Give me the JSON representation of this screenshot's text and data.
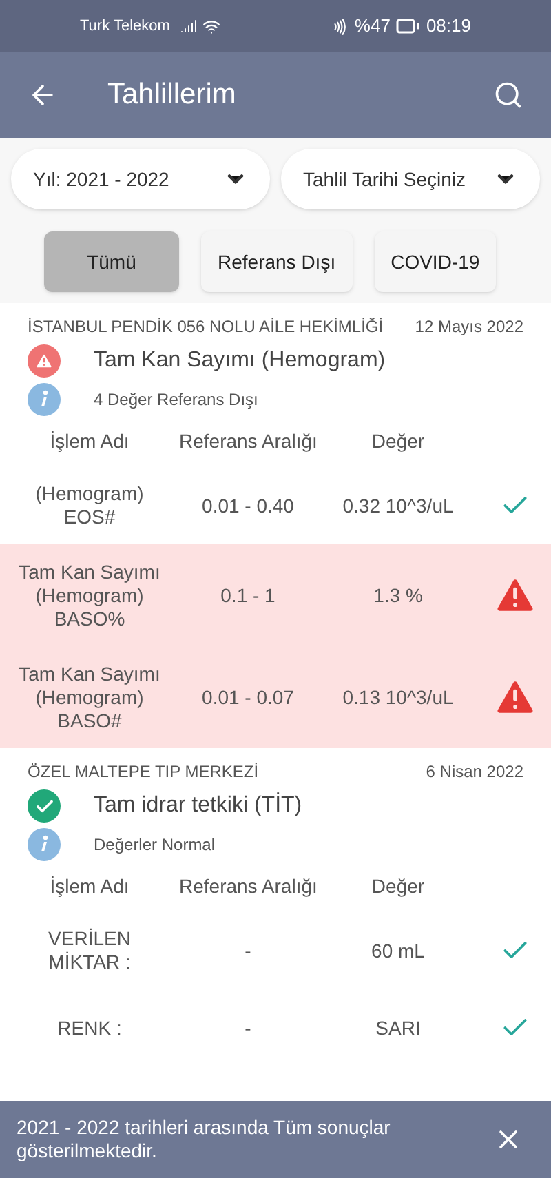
{
  "status_bar": {
    "carrier": "Turk Telekom",
    "battery": "%47",
    "time": "08:19"
  },
  "app_bar": {
    "title": "Tahlillerim"
  },
  "filters": [
    {
      "label": "Yıl: 2021 - 2022"
    },
    {
      "label": "Tahlil Tarihi Seçiniz"
    }
  ],
  "chips": [
    {
      "label": "Tümü",
      "selected": true
    },
    {
      "label": "Referans Dışı",
      "selected": false
    },
    {
      "label": "COVID-19",
      "selected": false
    }
  ],
  "groups": [
    {
      "place": "İSTANBUL PENDİK 056 NOLU AİLE HEKİMLİĞİ",
      "date": "12 Mayıs 2022",
      "test": "Tam Kan Sayımı (Hemogram)",
      "abnormal": true,
      "note": "4 Değer Referans Dışı",
      "columns": [
        "İşlem Adı",
        "Referans Aralığı",
        "Değer"
      ],
      "rows": [
        {
          "name": [
            "(Hemogram)",
            "EOS#"
          ],
          "range": "0.01 - 0.40",
          "value": "0.32 10^3/uL",
          "out_of_range": false
        },
        {
          "name": [
            "Tam Kan Sayımı",
            "(Hemogram)",
            "BASO%"
          ],
          "range": "0.1 - 1",
          "value": "1.3 %",
          "out_of_range": true
        },
        {
          "name": [
            "Tam Kan Sayımı",
            "(Hemogram)",
            "BASO#"
          ],
          "range": "0.01 - 0.07",
          "value": "0.13 10^3/uL",
          "out_of_range": true
        }
      ]
    },
    {
      "place": "ÖZEL MALTEPE TIP MERKEZİ",
      "date": "6 Nisan 2022",
      "test": "Tam idrar tetkiki (TİT)",
      "abnormal": false,
      "note": "Değerler Normal",
      "columns": [
        "İşlem Adı",
        "Referans Aralığı",
        "Değer"
      ],
      "rows": [
        {
          "name": [
            "VERİLEN",
            "MİKTAR :"
          ],
          "range": "-",
          "value": "60 mL",
          "out_of_range": false
        },
        {
          "name": [
            "RENK :"
          ],
          "range": "-",
          "value": "SARI",
          "out_of_range": false
        }
      ]
    }
  ],
  "snackbar": {
    "message": "2021 - 2022 tarihleri arasında Tüm sonuçlar gösterilmektedir."
  }
}
